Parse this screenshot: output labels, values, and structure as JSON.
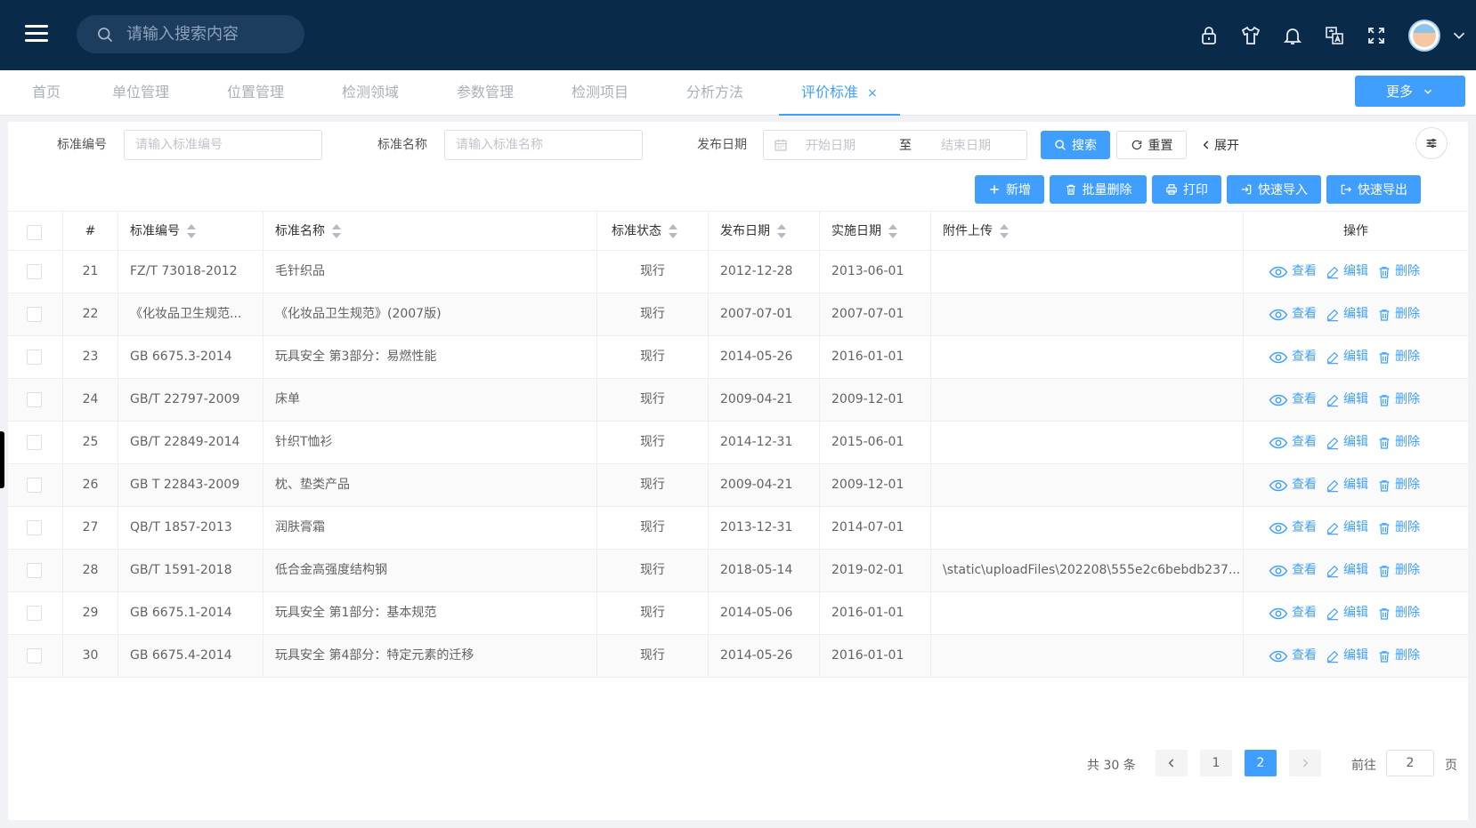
{
  "header": {
    "search_placeholder": "请输入搜索内容",
    "icons": [
      "lock-icon",
      "shirt-icon",
      "bell-icon",
      "translate-icon",
      "fullscreen-icon",
      "avatar",
      "chevron-down-icon"
    ]
  },
  "tabs": [
    {
      "label": "首页"
    },
    {
      "label": "单位管理"
    },
    {
      "label": "位置管理"
    },
    {
      "label": "检测领域"
    },
    {
      "label": "参数管理"
    },
    {
      "label": "检测项目"
    },
    {
      "label": "分析方法"
    },
    {
      "label": "评价标准",
      "active": true
    }
  ],
  "tab_close": "×",
  "more_button": "更多",
  "filters": {
    "code_label": "标准编号",
    "code_placeholder": "请输入标准编号",
    "name_label": "标准名称",
    "name_placeholder": "请输入标准名称",
    "date_label": "发布日期",
    "date_start_placeholder": "开始日期",
    "date_separator": "至",
    "date_end_placeholder": "结束日期",
    "search_button": "搜索",
    "reset_button": "重置",
    "expand_button": "展开"
  },
  "toolbar": {
    "add": "新增",
    "batch_delete": "批量删除",
    "print": "打印",
    "quick_import": "快速导入",
    "quick_export": "快速导出"
  },
  "table": {
    "columns": {
      "index": "#",
      "code": "标准编号",
      "name": "标准名称",
      "status": "标准状态",
      "publish_date": "发布日期",
      "effective_date": "实施日期",
      "attachment": "附件上传",
      "actions": "操作"
    },
    "action_labels": {
      "view": "查看",
      "edit": "编辑",
      "delete": "删除"
    },
    "rows": [
      {
        "index": "21",
        "code": "FZ/T 73018-2012",
        "name": "毛针织品",
        "status": "现行",
        "publish_date": "2012-12-28",
        "effective_date": "2013-06-01",
        "attachment": ""
      },
      {
        "index": "22",
        "code": "《化妆品卫生规范...",
        "name": "《化妆品卫生规范》(2007版)",
        "status": "现行",
        "publish_date": "2007-07-01",
        "effective_date": "2007-07-01",
        "attachment": ""
      },
      {
        "index": "23",
        "code": "GB 6675.3-2014",
        "name": "玩具安全 第3部分：易燃性能",
        "status": "现行",
        "publish_date": "2014-05-26",
        "effective_date": "2016-01-01",
        "attachment": ""
      },
      {
        "index": "24",
        "code": "GB/T 22797-2009",
        "name": "床单",
        "status": "现行",
        "publish_date": "2009-04-21",
        "effective_date": "2009-12-01",
        "attachment": ""
      },
      {
        "index": "25",
        "code": "GB/T 22849-2014",
        "name": "针织T恤衫",
        "status": "现行",
        "publish_date": "2014-12-31",
        "effective_date": "2015-06-01",
        "attachment": ""
      },
      {
        "index": "26",
        "code": "GB T 22843-2009",
        "name": "枕、垫类产品",
        "status": "现行",
        "publish_date": "2009-04-21",
        "effective_date": "2009-12-01",
        "attachment": ""
      },
      {
        "index": "27",
        "code": "QB/T 1857-2013",
        "name": "润肤膏霜",
        "status": "现行",
        "publish_date": "2013-12-31",
        "effective_date": "2014-07-01",
        "attachment": ""
      },
      {
        "index": "28",
        "code": "GB/T 1591-2018",
        "name": "低合金高强度结构钢",
        "status": "现行",
        "publish_date": "2018-05-14",
        "effective_date": "2019-02-01",
        "attachment": "\\static\\uploadFiles\\202208\\555e2c6bebdb237..."
      },
      {
        "index": "29",
        "code": "GB 6675.1-2014",
        "name": "玩具安全 第1部分：基本规范",
        "status": "现行",
        "publish_date": "2014-05-06",
        "effective_date": "2016-01-01",
        "attachment": ""
      },
      {
        "index": "30",
        "code": "GB 6675.4-2014",
        "name": "玩具安全 第4部分：特定元素的迁移",
        "status": "现行",
        "publish_date": "2014-05-26",
        "effective_date": "2016-01-01",
        "attachment": ""
      }
    ]
  },
  "pagination": {
    "total_text": "共 30 条",
    "pages": [
      "1",
      "2"
    ],
    "current_page": "2",
    "goto_label": "前往",
    "goto_value": "2",
    "page_unit": "页"
  }
}
